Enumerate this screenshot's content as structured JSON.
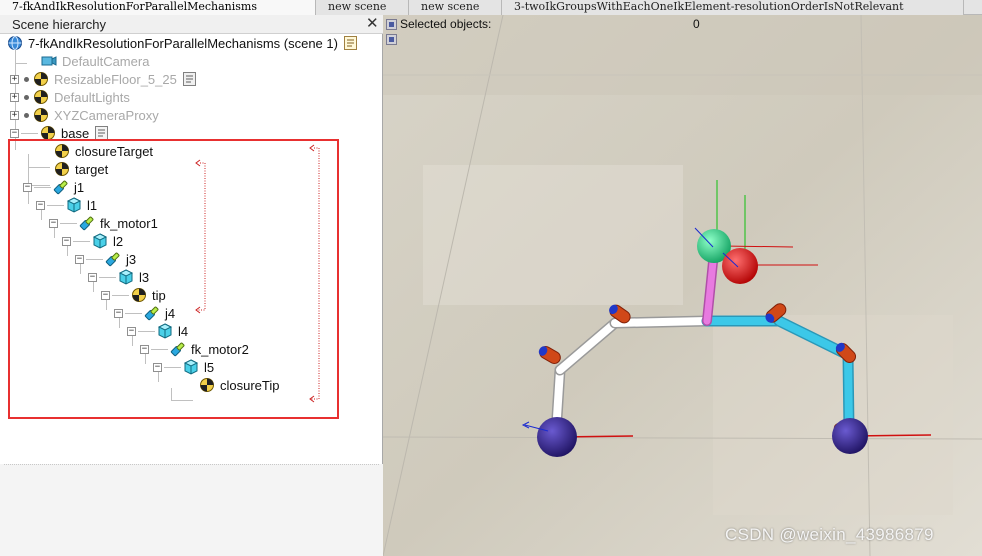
{
  "tabs": [
    {
      "label": "7-fkAndIkResolutionForParallelMechanisms",
      "active": true
    },
    {
      "label": "new scene",
      "active": false
    },
    {
      "label": "new scene",
      "active": false
    },
    {
      "label": "3-twoIkGroupsWithEachOneIkElement-resolutionOrderIsNotRelevant",
      "active": false
    }
  ],
  "hierarchy": {
    "title": "Scene hierarchy",
    "close_symbol": "✕",
    "root_label": "7-fkAndIkResolutionForParallelMechanisms (scene 1)",
    "items": [
      {
        "label": "DefaultCamera",
        "icon": "camera-icon",
        "greyed": true
      },
      {
        "label": "ResizableFloor_5_25",
        "icon": "dummy-icon",
        "greyed": true
      },
      {
        "label": "DefaultLights",
        "icon": "dummy-icon",
        "greyed": true
      },
      {
        "label": "XYZCameraProxy",
        "icon": "dummy-icon",
        "greyed": true
      },
      {
        "label": "base",
        "icon": "dummy-icon"
      },
      {
        "label": "closureTarget",
        "icon": "dummy-icon"
      },
      {
        "label": "target",
        "icon": "dummy-icon"
      },
      {
        "label": "j1",
        "icon": "joint-icon"
      },
      {
        "label": "l1",
        "icon": "shape-icon"
      },
      {
        "label": "fk_motor1",
        "icon": "joint-icon"
      },
      {
        "label": "l2",
        "icon": "shape-icon"
      },
      {
        "label": "j3",
        "icon": "joint-icon"
      },
      {
        "label": "l3",
        "icon": "shape-icon"
      },
      {
        "label": "tip",
        "icon": "dummy-icon"
      },
      {
        "label": "j4",
        "icon": "joint-icon"
      },
      {
        "label": "l4",
        "icon": "shape-icon"
      },
      {
        "label": "fk_motor2",
        "icon": "joint-icon"
      },
      {
        "label": "l5",
        "icon": "shape-icon"
      },
      {
        "label": "closureTip",
        "icon": "dummy-icon"
      }
    ]
  },
  "view": {
    "selected_label": "Selected objects:",
    "selected_count": "0"
  },
  "watermark": "CSDN @weixin_43986879",
  "colors": {
    "highlight": "#e83030",
    "link_red": "#cc2222",
    "link_white": "#ffffff",
    "link_cyan": "#3cc8e8",
    "link_pink": "#e87ae0",
    "joint_orange": "#d04818",
    "base_purple": "#32228a",
    "target_green": "#22d88a",
    "target_red": "#e01010"
  }
}
